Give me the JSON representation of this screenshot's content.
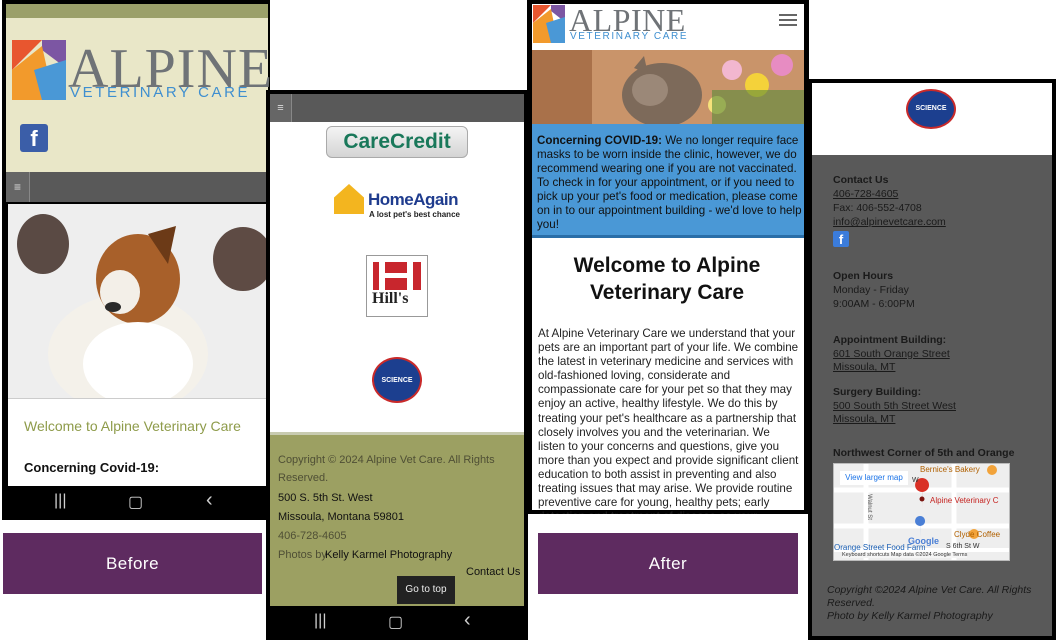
{
  "labels": {
    "before": "Before",
    "after": "After"
  },
  "before_phone_1": {
    "brand_name": "ALPINE",
    "brand_sub": "VETERINARY CARE",
    "facebook_glyph": "f",
    "menu_glyph": "≡",
    "welcome": "Welcome to Alpine Veterinary Care",
    "covid_heading": "Concerning Covid-19:",
    "sys_recents": "|||",
    "sys_home": "▢",
    "sys_back": "‹"
  },
  "before_phone_2": {
    "menu_glyph": "≡",
    "carecredit": "CareCredit",
    "homeagain": "HomeAgain",
    "homeagain_tag": "A lost pet's best chance",
    "hills": "Hill's",
    "science_diet": "SCIENCE DIET",
    "copyright": "Copyright © 2024 Alpine Vet Care. All Rights Reserved.",
    "address_line1": "500 S. 5th St. West",
    "address_line2": "Missoula, Montana 59801",
    "phone": "406-728-4605",
    "photos_prefix": "Photos by",
    "photos_name": "Kelly Karmel Photography",
    "go_to_top": "Go to top",
    "contact_us": "Contact Us",
    "sys_recents": "|||",
    "sys_home": "▢",
    "sys_back": "‹"
  },
  "after_phone_1": {
    "brand_name": "ALPINE",
    "brand_sub": "VETERINARY CARE",
    "notice_bold": "Concerning COVID-19:",
    "notice_text": " We no longer require face masks to be worn inside the clinic, however, we do recommend wearing one if you are not vaccinated. To check in for your appointment, or if you need to pick up your pet's food or medication, please come on in to our appointment building - we'd love to help you!",
    "heading": "Welcome to Alpine Veterinary Care",
    "paragraph": "At Alpine Veterinary Care we understand that your pets are an important part of your life. We combine the latest in veterinary medicine and services with old-fashioned loving, considerate and compassionate care for your pet so that they may enjoy an active, healthy lifestyle. We do this by treating your pet's healthcare as a partnership that closely involves you and the veterinarian. We listen to your concerns and questions, give you more than you expect and provide significant client education to both assist in preventing and also treating issues that may arise. We provide routine preventive care for young, healthy pets; early detection and treatment of disease as your"
  },
  "after_phone_2": {
    "science_diet": "SCIENCE DIET",
    "contact_heading": "Contact Us",
    "phone": "406-728-4605",
    "fax": "Fax: 406-552-4708",
    "email": "info@alpinevetcare.com",
    "facebook_glyph": "f",
    "hours_heading": "Open Hours",
    "hours_days": "Monday - Friday",
    "hours_time": "9:00AM - 6:00PM",
    "appt_heading": "Appointment Building:",
    "appt_line1": "601 South Orange Street",
    "appt_line2": "Missoula, MT",
    "surgery_heading": "Surgery Building:",
    "surgery_line1": "500 South 5th Street West",
    "surgery_line2": "Missoula, MT",
    "map_heading": "Northwest Corner of 5th and Orange",
    "map": {
      "larger_map": "View larger map",
      "bernice": "Bernice's Bakery",
      "alpine": "Alpine Veterinary C",
      "clyde": "Clyde Coffee",
      "orange_food": "Orange Street Food Farm",
      "street_5th": "S 6th St W",
      "walnut": "Walnut St",
      "w_label": "W",
      "google": "Google",
      "footer": "Keyboard shortcuts   Map data ©2024 Google   Terms"
    },
    "copyright": "Copyright ©2024 Alpine Vet Care. All Rights Reserved.",
    "photos": "Photo by Kelly Karmel Photography"
  },
  "colors": {
    "purple_label": "#5e2b60",
    "olive": "#9ca062",
    "blue_notice": "#4a98d6",
    "grey_footer": "#595959",
    "brand_blue": "#3f8fd0"
  }
}
